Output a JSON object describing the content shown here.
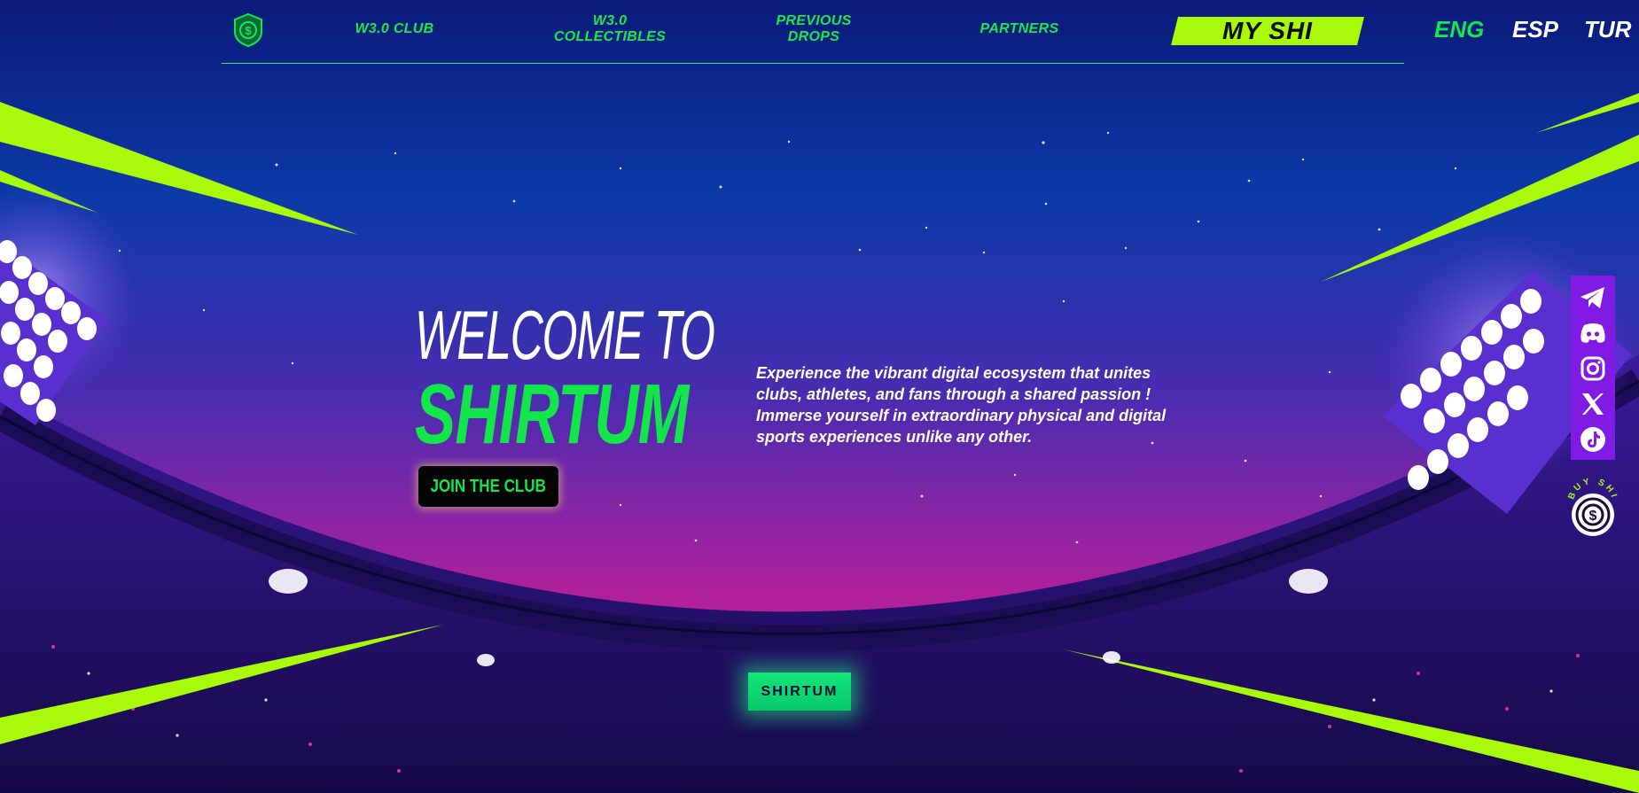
{
  "nav": {
    "logo_icon": "shirtum-shield-icon",
    "links": [
      {
        "label": "W3.0 CLUB"
      },
      {
        "label": "W3.0\nCOLLECTIBLES"
      },
      {
        "label": "PREVIOUS\nDROPS"
      },
      {
        "label": "PARTNERS"
      }
    ],
    "cta_label": "MY SHI",
    "languages": [
      {
        "label": "ENG",
        "active": true
      },
      {
        "label": "ESP",
        "active": false
      },
      {
        "label": "TUR",
        "active": false
      }
    ]
  },
  "hero": {
    "welcome": "WELCOME TO",
    "brand": "SHIRTUM",
    "join_label": "JOIN THE CLUB",
    "description": "Experience the vibrant digital ecosystem that unites\nclubs, athletes, and fans through a shared passion !\nImmerse yourself in extraordinary physical and digital\nsports experiences unlike any other."
  },
  "social": {
    "icons": [
      "telegram-icon",
      "discord-icon",
      "instagram-icon",
      "x-twitter-icon",
      "tiktok-icon"
    ],
    "buy_label": "BUY SHI"
  },
  "footer_badge": "SHIRTUM",
  "colors": {
    "accent_green": "#13e64b",
    "lime": "#a8f90a",
    "purple": "#7f1be3",
    "sky_top": "#0d1f8a",
    "sky_bottom": "#c0209a"
  }
}
